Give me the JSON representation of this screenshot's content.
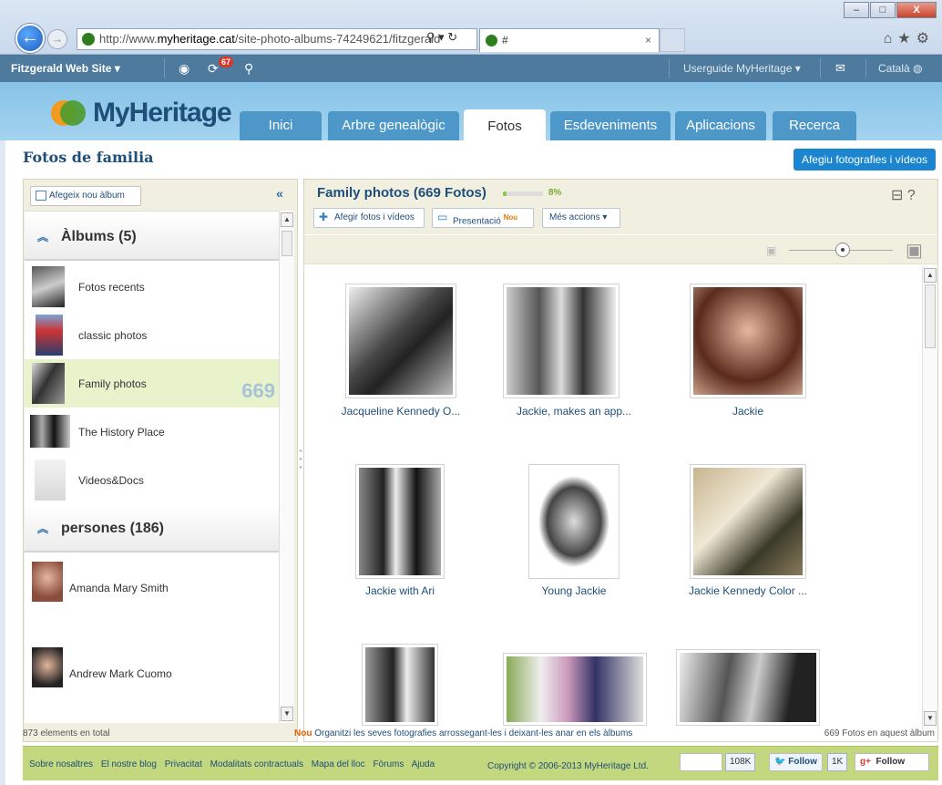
{
  "browser": {
    "url_prefix": "http://www.",
    "url_host": "myheritage.cat",
    "url_path": "/site-photo-albums-74249621/fitzgerald",
    "addr_icons": "⚲ ▾ ↻",
    "tab_title": "#",
    "tab_close": "×",
    "window_buttons": {
      "minimize": "–",
      "maximize": "□",
      "close": "X"
    },
    "tools": "⌂★⚙"
  },
  "topbar": {
    "site_name": "Fitzgerald Web Site ▾",
    "notifications_count": "67",
    "user_menu": "Userguide MyHeritage ▾",
    "language": "Català"
  },
  "logo": {
    "text": "MyHeritage"
  },
  "nav": {
    "tabs": [
      {
        "label": "Inici"
      },
      {
        "label": "Arbre genealògic"
      },
      {
        "label": "Fotos"
      },
      {
        "label": "Esdeveniments"
      },
      {
        "label": "Aplicacions"
      },
      {
        "label": "Recerca"
      }
    ],
    "active": "Fotos"
  },
  "page": {
    "title": "Fotos de familia",
    "add_button": "Afegiu fotografies i vídeos"
  },
  "sidebar": {
    "new_album": "Afegeix nou àlbum",
    "collapse": "«",
    "albums_header": "Àlbums (5)",
    "albums": [
      {
        "label": "Fotos recents"
      },
      {
        "label": "classic photos"
      },
      {
        "label": "Family photos",
        "count": "669"
      },
      {
        "label": "The History Place"
      },
      {
        "label": "Videos&Docs"
      }
    ],
    "people_header": "persones (186)",
    "people": [
      {
        "label": "Amanda Mary Smith"
      },
      {
        "label": "Andrew Mark Cuomo"
      }
    ]
  },
  "album": {
    "title": "Family photos (669 Fotos)",
    "progress_percent": 8,
    "progress_label": "8%",
    "toolbar": {
      "add": "Afegir fotos i vídeos",
      "slideshow": "Presentació",
      "slideshow_badge": "Nou",
      "more": "Més accions ▾"
    },
    "help": "?",
    "photos": [
      {
        "caption": "Jacqueline Kennedy O..."
      },
      {
        "caption": "Jackie, makes an app..."
      },
      {
        "caption": "Jackie"
      },
      {
        "caption": "Jackie with Ari"
      },
      {
        "caption": "Young Jackie"
      },
      {
        "caption": "Jackie Kennedy Color ..."
      }
    ]
  },
  "status": {
    "total": "873 elements en total",
    "tip_badge": "Nou",
    "tip": "Organitzi les seves fotografies arrossegant-les i deixant-les anar en els àlbums",
    "album_count": "669 Fotos en aquest àlbum"
  },
  "footer": {
    "links": [
      "Sobre nosaltres",
      "El nostre blog",
      "Privacitat",
      "Modalitats contractuals",
      "Mapa del lloc",
      "Fòrums",
      "Ajuda"
    ],
    "copyright": "Copyright © 2006-2013 MyHeritage Ltd.",
    "like_count": "108K",
    "twitter": "Follow",
    "twitter_count": "1K",
    "gplus": "Follow"
  }
}
